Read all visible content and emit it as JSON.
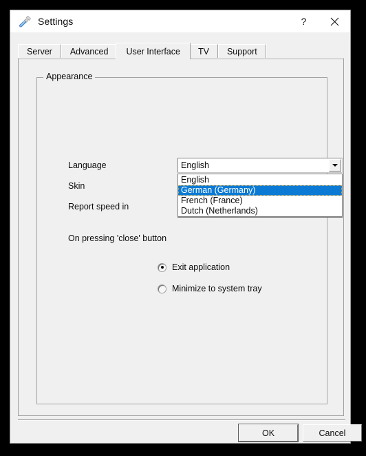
{
  "window": {
    "title": "Settings",
    "icon": "screwdriver-icon",
    "help_label": "?",
    "close_label": "✕"
  },
  "tabs": [
    {
      "label": "Server",
      "active": false
    },
    {
      "label": "Advanced",
      "active": false
    },
    {
      "label": "User Interface",
      "active": true
    },
    {
      "label": "TV",
      "active": false
    },
    {
      "label": "Support",
      "active": false
    }
  ],
  "appearance": {
    "legend": "Appearance",
    "language_label": "Language",
    "skin_label": "Skin",
    "report_speed_label": "Report speed in",
    "language_value": "English",
    "language_options": [
      {
        "label": "English",
        "selected": false
      },
      {
        "label": "German (Germany)",
        "selected": true
      },
      {
        "label": "French (France)",
        "selected": false
      },
      {
        "label": "Dutch (Netherlands)",
        "selected": false
      }
    ]
  },
  "close_behavior": {
    "label": "On pressing 'close' button",
    "options": [
      {
        "label": "Exit application",
        "checked": true
      },
      {
        "label": "Minimize to system tray",
        "checked": false
      }
    ]
  },
  "buttons": {
    "ok": "OK",
    "cancel": "Cancel"
  },
  "colors": {
    "dialog_background": "#f0f0f0",
    "titlebar_background": "#ffffff",
    "selection_blue": "#0a7ad4",
    "field_background": "#ffffff",
    "border_gray": "#a0a0a0",
    "text": "#0a0a0a"
  }
}
